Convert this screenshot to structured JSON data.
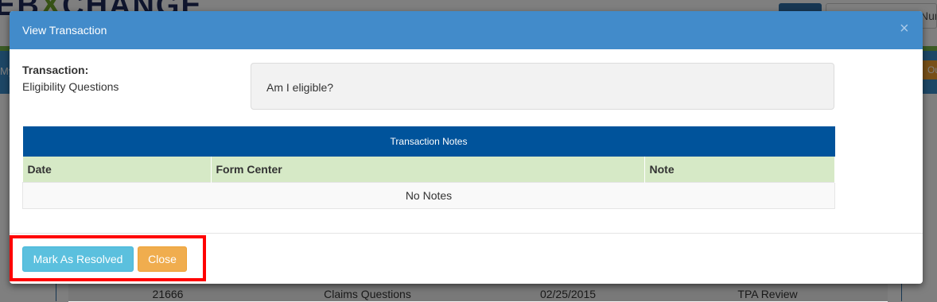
{
  "background": {
    "logo_text": "EBEXCHANGE",
    "search_placeholder": "Numbe",
    "nav_left": "My",
    "nav_right": "Ou",
    "row": [
      "21666",
      "Claims Questions",
      "02/25/2015",
      "TPA Review"
    ]
  },
  "modal": {
    "title": "View Transaction",
    "close_glyph": "×",
    "transaction_label": "Transaction:",
    "transaction_type": "Eligibility Questions",
    "message": "Am I eligible?",
    "notes": {
      "caption": "Transaction Notes",
      "columns": [
        "Date",
        "Form Center",
        "Note"
      ],
      "empty_text": "No Notes"
    },
    "footer": {
      "resolve_label": "Mark As Resolved",
      "close_label": "Close"
    }
  },
  "colors": {
    "header": "#428bca",
    "table_caption": "#00539b",
    "table_head": "#d6e9c6",
    "resolve_button": "#5bc0de",
    "close_button": "#f0ad4e",
    "highlight": "#ff0000"
  }
}
